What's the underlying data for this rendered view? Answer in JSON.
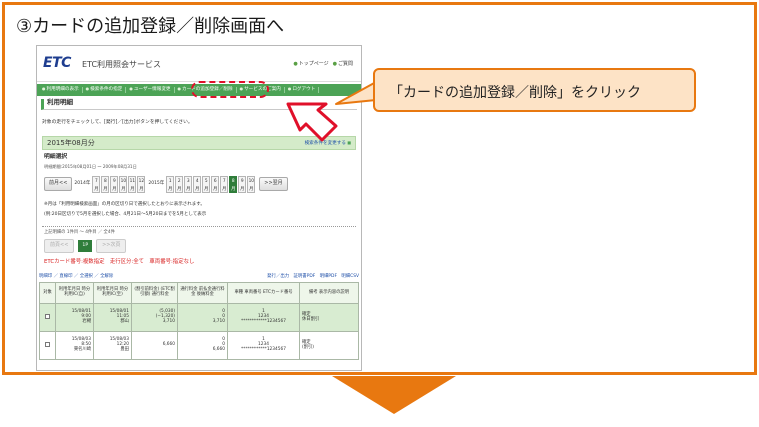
{
  "heading": "③カードの追加登録／削除画面へ",
  "callout": "「カードの追加登録／削除」をクリック",
  "site": {
    "logo": "ETC",
    "name": "ETC利用照会サービス",
    "links": [
      "トップページ",
      "ご質問"
    ]
  },
  "nav": [
    "利用明細の表示",
    "検索条件の指定",
    "ユーザー情報変更",
    "カードの追加登録／削除",
    "サービスのご案内",
    "ログアウト"
  ],
  "page": {
    "title": "利用明細",
    "instruction": "対象の走行をチェックして、[発行]／[出力]ボタンを押してください。",
    "month_title": "2015年08月分",
    "change_link": "検索条件を変更する",
    "section_title": "明細選択",
    "period": "明細期間:2015年08月01日 〜 2009年08月31日",
    "prev_month": "前月<<",
    "next_month": ">>翌月",
    "year1": "2014年",
    "year2": "2015年",
    "months_2014": [
      "7月",
      "8月",
      "9月",
      "10月",
      "11月",
      "12月"
    ],
    "months_2015": [
      "1月",
      "2月",
      "3月",
      "4月",
      "5月",
      "6月",
      "7月",
      "8月",
      "9月",
      "10月"
    ],
    "note1": "※月は「利用明細検索画面」の月の区切り日で選択したとおりに表示されます。",
    "note2": "(例:20日区切りで5月を選択した場合、4月21日〜5月20日までを5月として表示",
    "range": "上記明細の 1件目 〜 4件目 ／ 全4件",
    "pager_prev": "前頁<<",
    "pager_cur": "1P",
    "pager_next": ">>次頁",
    "card_filter": "ETCカード番号:複数指定　走行区分:全て　車両番号:指定なし",
    "tools_left": "明細印 ／ 直線印 ／ 全選択 ／ 全解除",
    "tools_right": "発行／出力　証明書PDF　明細PDF　明細CSV",
    "headers": [
      "対象",
      "利用年月日 時分 利用IC(自)",
      "利用年月日 時分 利用IC(至)",
      "(割引前料金) (ETC割引額) 通行料金",
      "通行料金 前払金通行料金 後納料金",
      "車種 車両番号 ETCカード番号",
      "備考 表示内容の説明"
    ],
    "rows": [
      {
        "a": [
          "15/08/01",
          "9:00",
          "岩槻"
        ],
        "b": [
          "15/08/01",
          "11:05",
          "郡山"
        ],
        "c": [
          "(5,030)",
          "(−1,320)",
          "3,710"
        ],
        "d": [
          "0",
          "0",
          "3,710"
        ],
        "e": [
          "1",
          "1234",
          "************1234567"
        ],
        "f": [
          "確定",
          "休日割引"
        ]
      },
      {
        "a": [
          "15/08/03",
          "8:50",
          "東名川崎"
        ],
        "b": [
          "15/08/03",
          "12:20",
          "豊田"
        ],
        "c": [
          "",
          "",
          "6,660"
        ],
        "d": [
          "0",
          "0",
          "6,660"
        ],
        "e": [
          "1",
          "1234",
          "************1234567"
        ],
        "f": [
          "確定",
          "(割引)"
        ]
      }
    ]
  },
  "colors": {
    "accent": "#e87810",
    "nav_green": "#4ca356",
    "callout_fill": "#fde3c6",
    "highlight_red": "#e0102a"
  }
}
